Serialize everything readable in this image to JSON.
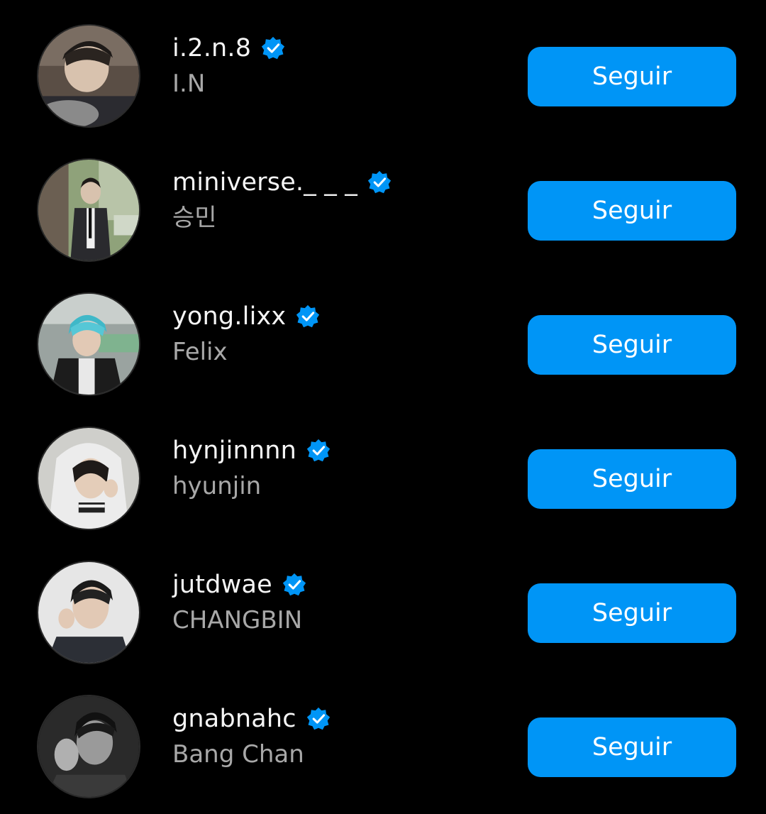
{
  "accent_color": "#0095f6",
  "verified_badge_color": "#0095f6",
  "background_color": "#000000",
  "accounts": [
    {
      "username": "i.2.n.8",
      "full_name": "I.N",
      "verified": true,
      "button_label": "Seguir",
      "avatar": "profile-photo-in"
    },
    {
      "username": "miniverse._ _ _",
      "full_name": "승민",
      "verified": true,
      "button_label": "Seguir",
      "avatar": "profile-photo-seungmin"
    },
    {
      "username": "yong.lixx",
      "full_name": "Felix",
      "verified": true,
      "button_label": "Seguir",
      "avatar": "profile-photo-felix"
    },
    {
      "username": "hynjinnnn",
      "full_name": "hyunjin",
      "verified": true,
      "button_label": "Seguir",
      "avatar": "profile-photo-hyunjin"
    },
    {
      "username": "jutdwae",
      "full_name": "CHANGBIN",
      "verified": true,
      "button_label": "Seguir",
      "avatar": "profile-photo-changbin"
    },
    {
      "username": "gnabnahc",
      "full_name": "Bang Chan",
      "verified": true,
      "button_label": "Seguir",
      "avatar": "profile-photo-bangchan"
    }
  ]
}
